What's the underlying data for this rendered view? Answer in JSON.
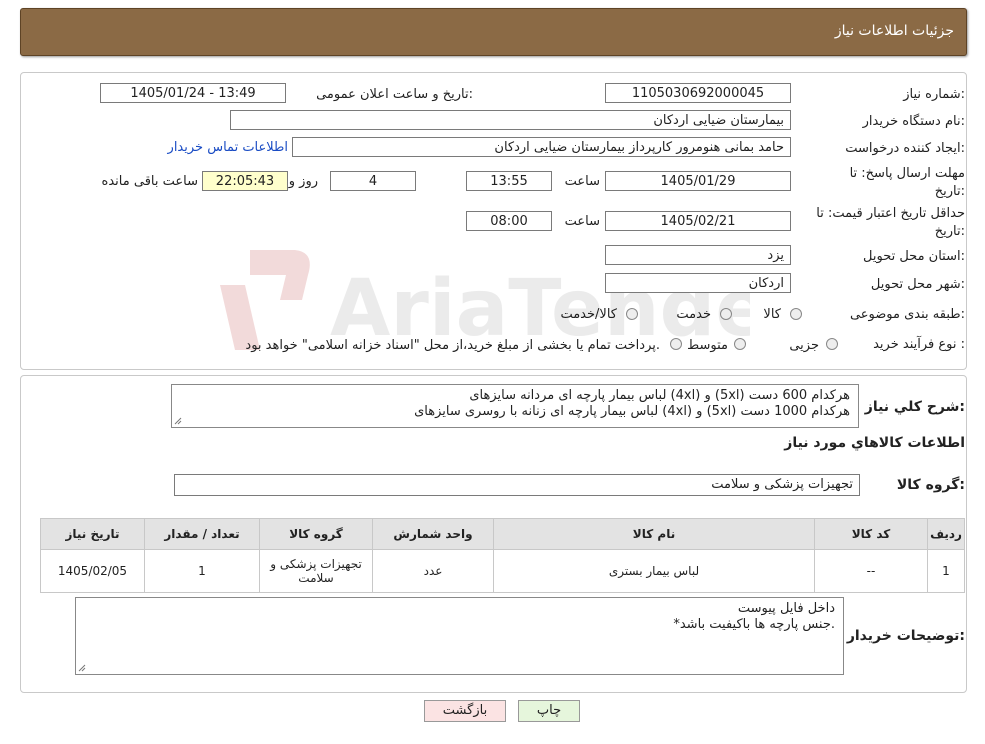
{
  "header": {
    "title": "جزئیات اطلاعات نیاز"
  },
  "form": {
    "need_number_label": "شماره نیاز:",
    "need_number": "1105030692000045",
    "announce_label": "تاریخ و ساعت اعلان عمومی:",
    "announce_value": "1405/01/24 - 13:49",
    "buyer_org_label": "نام دستگاه خریدار:",
    "buyer_org": "بیمارستان ضیایی اردکان",
    "creator_label": "ایجاد کننده درخواست:",
    "creator": "حامد بمانی هنومرور کارپرداز بیمارستان ضیایی اردکان",
    "contact_link": "اطلاعات تماس خریدار",
    "deadline_label_1": "مهلت ارسال پاسخ: تا",
    "deadline_label_2": "تاریخ:",
    "deadline_date": "1405/01/29",
    "time_label": "ساعت",
    "deadline_time": "13:55",
    "days_value": "4",
    "days_label": "روز و",
    "remaining_time": "22:05:43",
    "remaining_label": "ساعت باقی مانده",
    "validity_label_1": "حداقل تاریخ اعتبار قیمت: تا",
    "validity_label_2": "تاریخ:",
    "validity_date": "1405/02/21",
    "validity_time": "08:00",
    "province_label": "استان محل تحویل:",
    "province": "یزد",
    "city_label": "شهر محل تحویل:",
    "city": "اردکان",
    "category_label": "طبقه بندی موضوعی:",
    "category_options": [
      "کالا",
      "خدمت",
      "کالا/خدمت"
    ],
    "process_label": "نوع فرآیند خرید :",
    "process_options": [
      "جزیی",
      "متوسط"
    ],
    "process_note": "پرداخت تمام یا بخشی از مبلغ خرید،از محل \"اسناد خزانه اسلامی\" خواهد بود."
  },
  "description": {
    "label": "شرح کلي نياز:",
    "line1": "لباس بیمار پارچه ای مردانه سایزهای (4xl) و (5xl) هرکدام 600 دست",
    "line2": "لباس بیمار پارچه ای زنانه با روسری سایزهای (4xl) و (5xl) هرکدام 1000 دست"
  },
  "goods": {
    "section_title": "اطلاعات کالاهاي مورد نياز",
    "group_label": "گروه کالا:",
    "group_value": "تجهیزات پزشکی و سلامت",
    "columns": [
      "ردیف",
      "کد کالا",
      "نام کالا",
      "واحد شمارش",
      "گروه کالا",
      "تعداد / مقدار",
      "تاریخ نیاز"
    ],
    "rows": [
      [
        "1",
        "--",
        "لباس بیمار بستری",
        "عدد",
        "تجهیزات پزشکی و سلامت",
        "1",
        "1405/02/05"
      ]
    ]
  },
  "buyer_notes": {
    "label": "توضیحات خریدار:",
    "line1": "داخل فایل پیوست",
    "line2": "*جنس پارچه ها باکیفیت باشد."
  },
  "buttons": {
    "print": "چاپ",
    "back": "بازگشت"
  },
  "watermark_text": "AriaTender.neT",
  "colors": {
    "header_bg": "#8b6a45",
    "back_button_bg": "#fbe3e3",
    "print_button_bg": "#e6f6dc",
    "link": "#1a4cc4"
  }
}
